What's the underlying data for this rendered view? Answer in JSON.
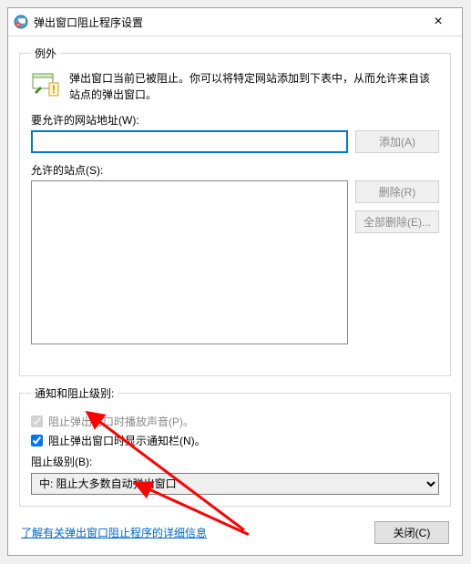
{
  "window": {
    "title": "弹出窗口阻止程序设置",
    "close_label": "×"
  },
  "exceptions": {
    "legend": "例外",
    "intro": "弹出窗口当前已被阻止。你可以将特定网站添加到下表中，从而允许来自该站点的弹出窗口。",
    "address_label": "要允许的网站地址(W):",
    "address_value": "",
    "add_btn": "添加(A)",
    "sites_label": "允许的站点(S):",
    "remove_btn": "删除(R)",
    "remove_all_btn": "全部删除(E)..."
  },
  "levels": {
    "legend": "通知和阻止级别:",
    "play_sound_label": "阻止弹出窗口时播放声音(P)。",
    "play_sound_checked": true,
    "show_bar_label": "阻止弹出窗口时显示通知栏(N)。",
    "show_bar_checked": true,
    "level_label": "阻止级别(B):",
    "level_selected": "中: 阻止大多数自动弹出窗口"
  },
  "footer": {
    "learn_link": "了解有关弹出窗口阻止程序的详细信息",
    "close_btn": "关闭(C)"
  }
}
